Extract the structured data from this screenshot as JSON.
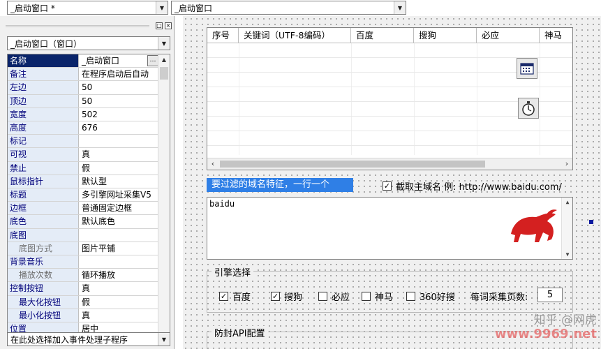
{
  "toolbar": {
    "form_combo_value": "_启动窗口 *",
    "object_combo_value": "_启动窗口"
  },
  "panel": {
    "pin_icon": "pin-icon",
    "close_icon": "close-icon",
    "object_selector": "_启动窗口（窗口）",
    "properties": [
      {
        "name": "名称",
        "value": "_启动窗口",
        "selected": true
      },
      {
        "name": "备注",
        "value": "在程序启动后自动"
      },
      {
        "name": "左边",
        "value": "50"
      },
      {
        "name": "顶边",
        "value": "50"
      },
      {
        "name": "宽度",
        "value": "502"
      },
      {
        "name": "高度",
        "value": "676"
      },
      {
        "name": "标记",
        "value": ""
      },
      {
        "name": "可视",
        "value": "真"
      },
      {
        "name": "禁止",
        "value": "假"
      },
      {
        "name": "鼠标指针",
        "value": "默认型"
      },
      {
        "name": "标题",
        "value": "多引擎网址采集V5"
      },
      {
        "name": "边框",
        "value": "普通固定边框"
      },
      {
        "name": "底色",
        "value": "默认底色"
      },
      {
        "name": "底图",
        "value": ""
      },
      {
        "name": "底图方式",
        "value": "图片平铺",
        "sub": true,
        "gray": true
      },
      {
        "name": "背景音乐",
        "value": ""
      },
      {
        "name": "播放次数",
        "value": "循环播放",
        "sub": true,
        "gray": true
      },
      {
        "name": "控制按钮",
        "value": "真"
      },
      {
        "name": "最大化按钮",
        "value": "假",
        "sub": true
      },
      {
        "name": "最小化按钮",
        "value": "真",
        "sub": true
      },
      {
        "name": "位置",
        "value": "居中"
      }
    ],
    "ellipsis": "…",
    "event_combo": "在此处选择加入事件处理子程序"
  },
  "designer": {
    "table_headers": [
      "序号",
      "关键词（UTF-8编码）",
      "百度",
      "搜狗",
      "必应",
      "神马"
    ],
    "calendar_icon": "calendar-icon",
    "timer_icon": "stopwatch-icon",
    "filter_label": "要过滤的域名特征，一行一个",
    "main_domain_checked": true,
    "main_domain_label": "截取主域名 例: http://www.baidu.com/",
    "domain_text": "baidu",
    "bull_image": "red-bull-logo",
    "engine_group_title": "引擎选择",
    "engines": [
      {
        "label": "百度",
        "checked": true
      },
      {
        "label": "搜狗",
        "checked": true
      },
      {
        "label": "必应",
        "checked": false
      },
      {
        "label": "神马",
        "checked": false
      },
      {
        "label": "360好搜",
        "checked": false
      }
    ],
    "pages_label": "每词采集页数:",
    "pages_value": "5",
    "api_group_title": "防封API配置"
  },
  "watermark": {
    "line1": "知乎 @网虎",
    "line2": "www.9969.net"
  },
  "colors": {
    "selection": "#0a246a",
    "label_highlight": "#2f7fe6",
    "bull_red": "#d42020"
  }
}
